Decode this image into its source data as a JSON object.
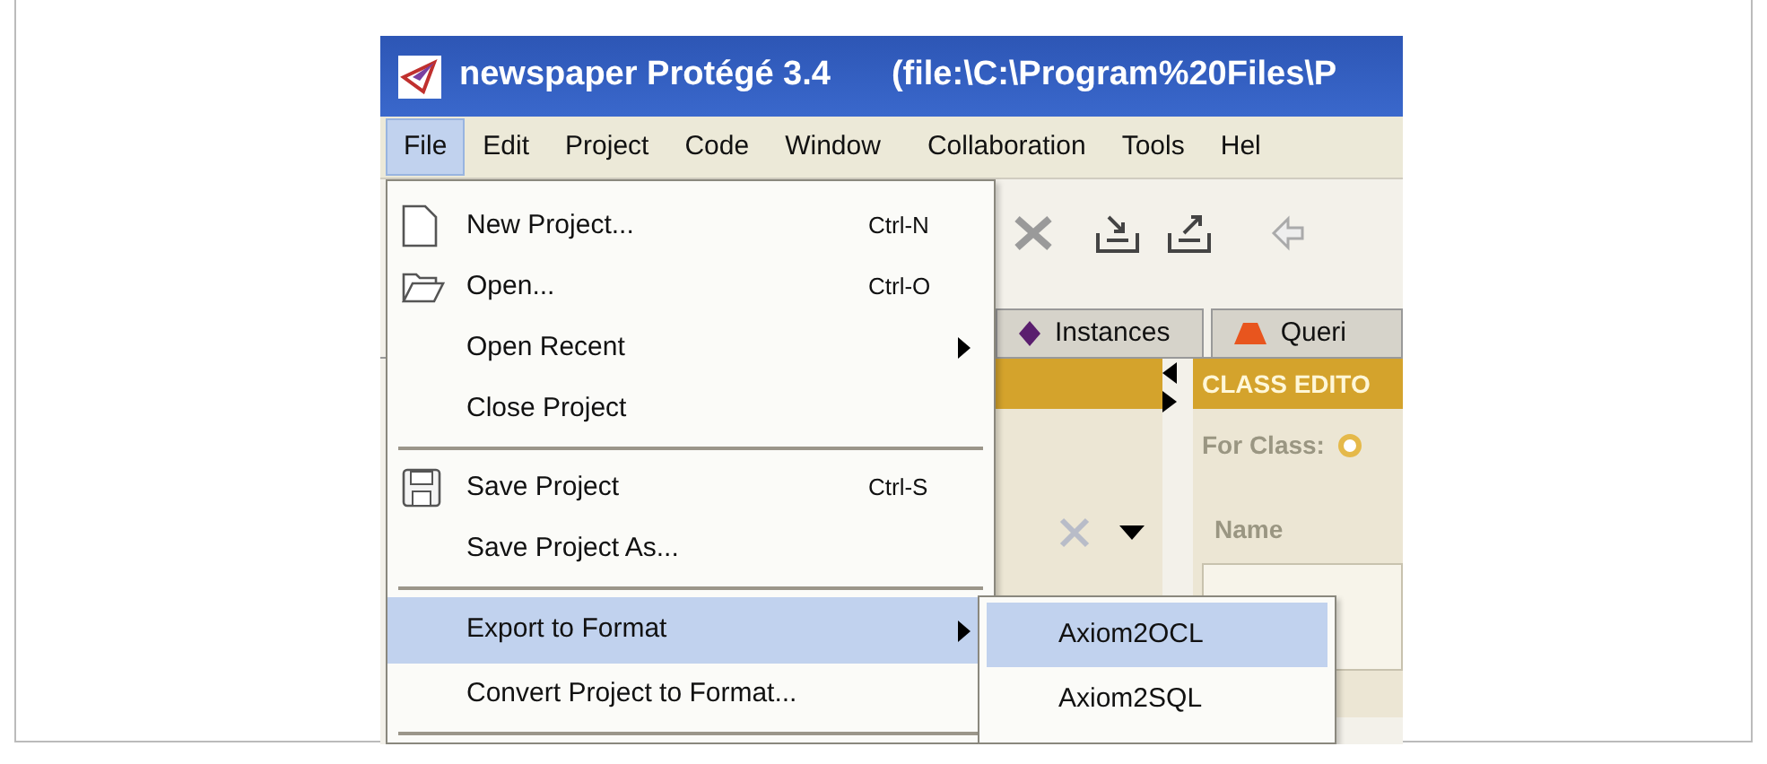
{
  "window": {
    "title": "newspaper  Protégé 3.4",
    "path": "(file:\\C:\\Program%20Files\\P"
  },
  "menubar": [
    {
      "label": "File",
      "selected": true
    },
    {
      "label": "Edit",
      "selected": false
    },
    {
      "label": "Project",
      "selected": false
    },
    {
      "label": "Code",
      "selected": false
    },
    {
      "label": "Window",
      "selected": false
    },
    {
      "label": "Collaboration",
      "selected": false
    },
    {
      "label": "Tools",
      "selected": false
    },
    {
      "label": "Hel",
      "selected": false
    }
  ],
  "file_menu": [
    {
      "kind": "item",
      "label": "New Project...",
      "shortcut": "Ctrl-N",
      "selected": false
    },
    {
      "kind": "item",
      "label": "Open...",
      "shortcut": "Ctrl-O",
      "selected": false
    },
    {
      "kind": "submenu",
      "label": "Open Recent",
      "selected": false
    },
    {
      "kind": "item",
      "label": "Close Project",
      "selected": false
    },
    {
      "kind": "separator"
    },
    {
      "kind": "item",
      "label": "Save Project",
      "shortcut": "Ctrl-S",
      "selected": false
    },
    {
      "kind": "item",
      "label": "Save Project As...",
      "selected": false
    },
    {
      "kind": "separator"
    },
    {
      "kind": "submenu",
      "label": "Export to Format",
      "selected": true
    },
    {
      "kind": "item",
      "label": "Convert Project to Format...",
      "selected": false
    },
    {
      "kind": "separator"
    }
  ],
  "export_submenu": [
    {
      "label": "Axiom2OCL",
      "selected": true
    },
    {
      "label": "Axiom2SQL",
      "selected": false
    }
  ],
  "tabs": [
    {
      "label": "Instances"
    },
    {
      "label": "Queri"
    }
  ],
  "class_editor": {
    "title": "CLASS EDITO",
    "for_class": "For Class:",
    "column": "Name"
  }
}
